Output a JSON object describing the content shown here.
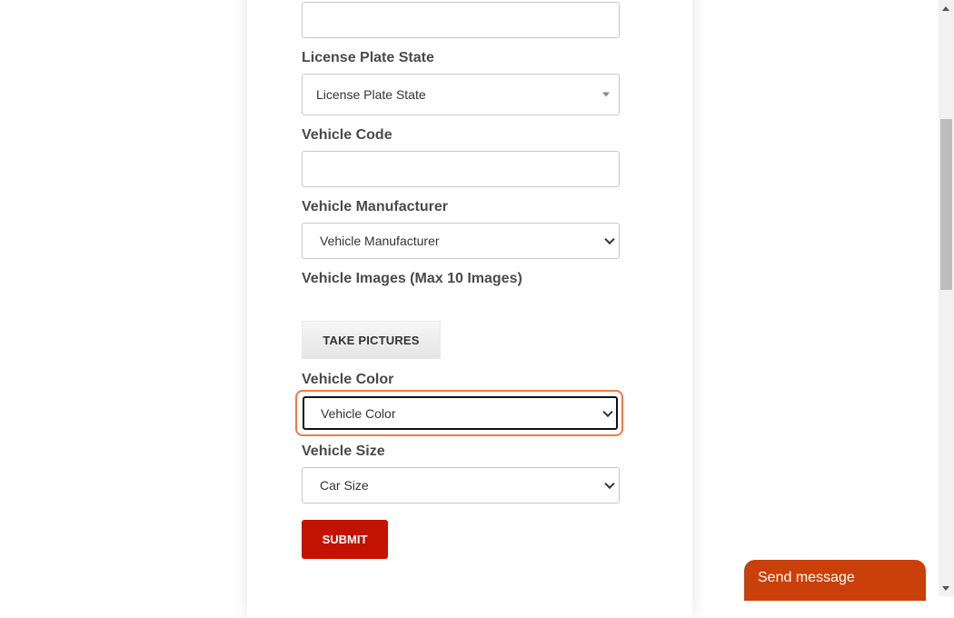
{
  "form": {
    "top_input": {
      "value": ""
    },
    "license_plate_state": {
      "label": "License Plate State",
      "selected": "License Plate State"
    },
    "vehicle_code": {
      "label": "Vehicle Code",
      "value": ""
    },
    "vehicle_manufacturer": {
      "label": "Vehicle Manufacturer",
      "selected": "Vehicle Manufacturer"
    },
    "vehicle_images": {
      "label": "Vehicle Images (Max 10 Images)",
      "button_label": "TAKE PICTURES"
    },
    "vehicle_color": {
      "label": "Vehicle Color",
      "selected": "Vehicle Color",
      "focused": true
    },
    "vehicle_size": {
      "label": "Vehicle Size",
      "selected": "Car Size"
    },
    "submit_label": "SUBMIT"
  },
  "chat_widget": {
    "label": "Send message"
  },
  "colors": {
    "submit": "#c41200",
    "chat": "#c9400a",
    "focus_ring": "#f07a45"
  }
}
